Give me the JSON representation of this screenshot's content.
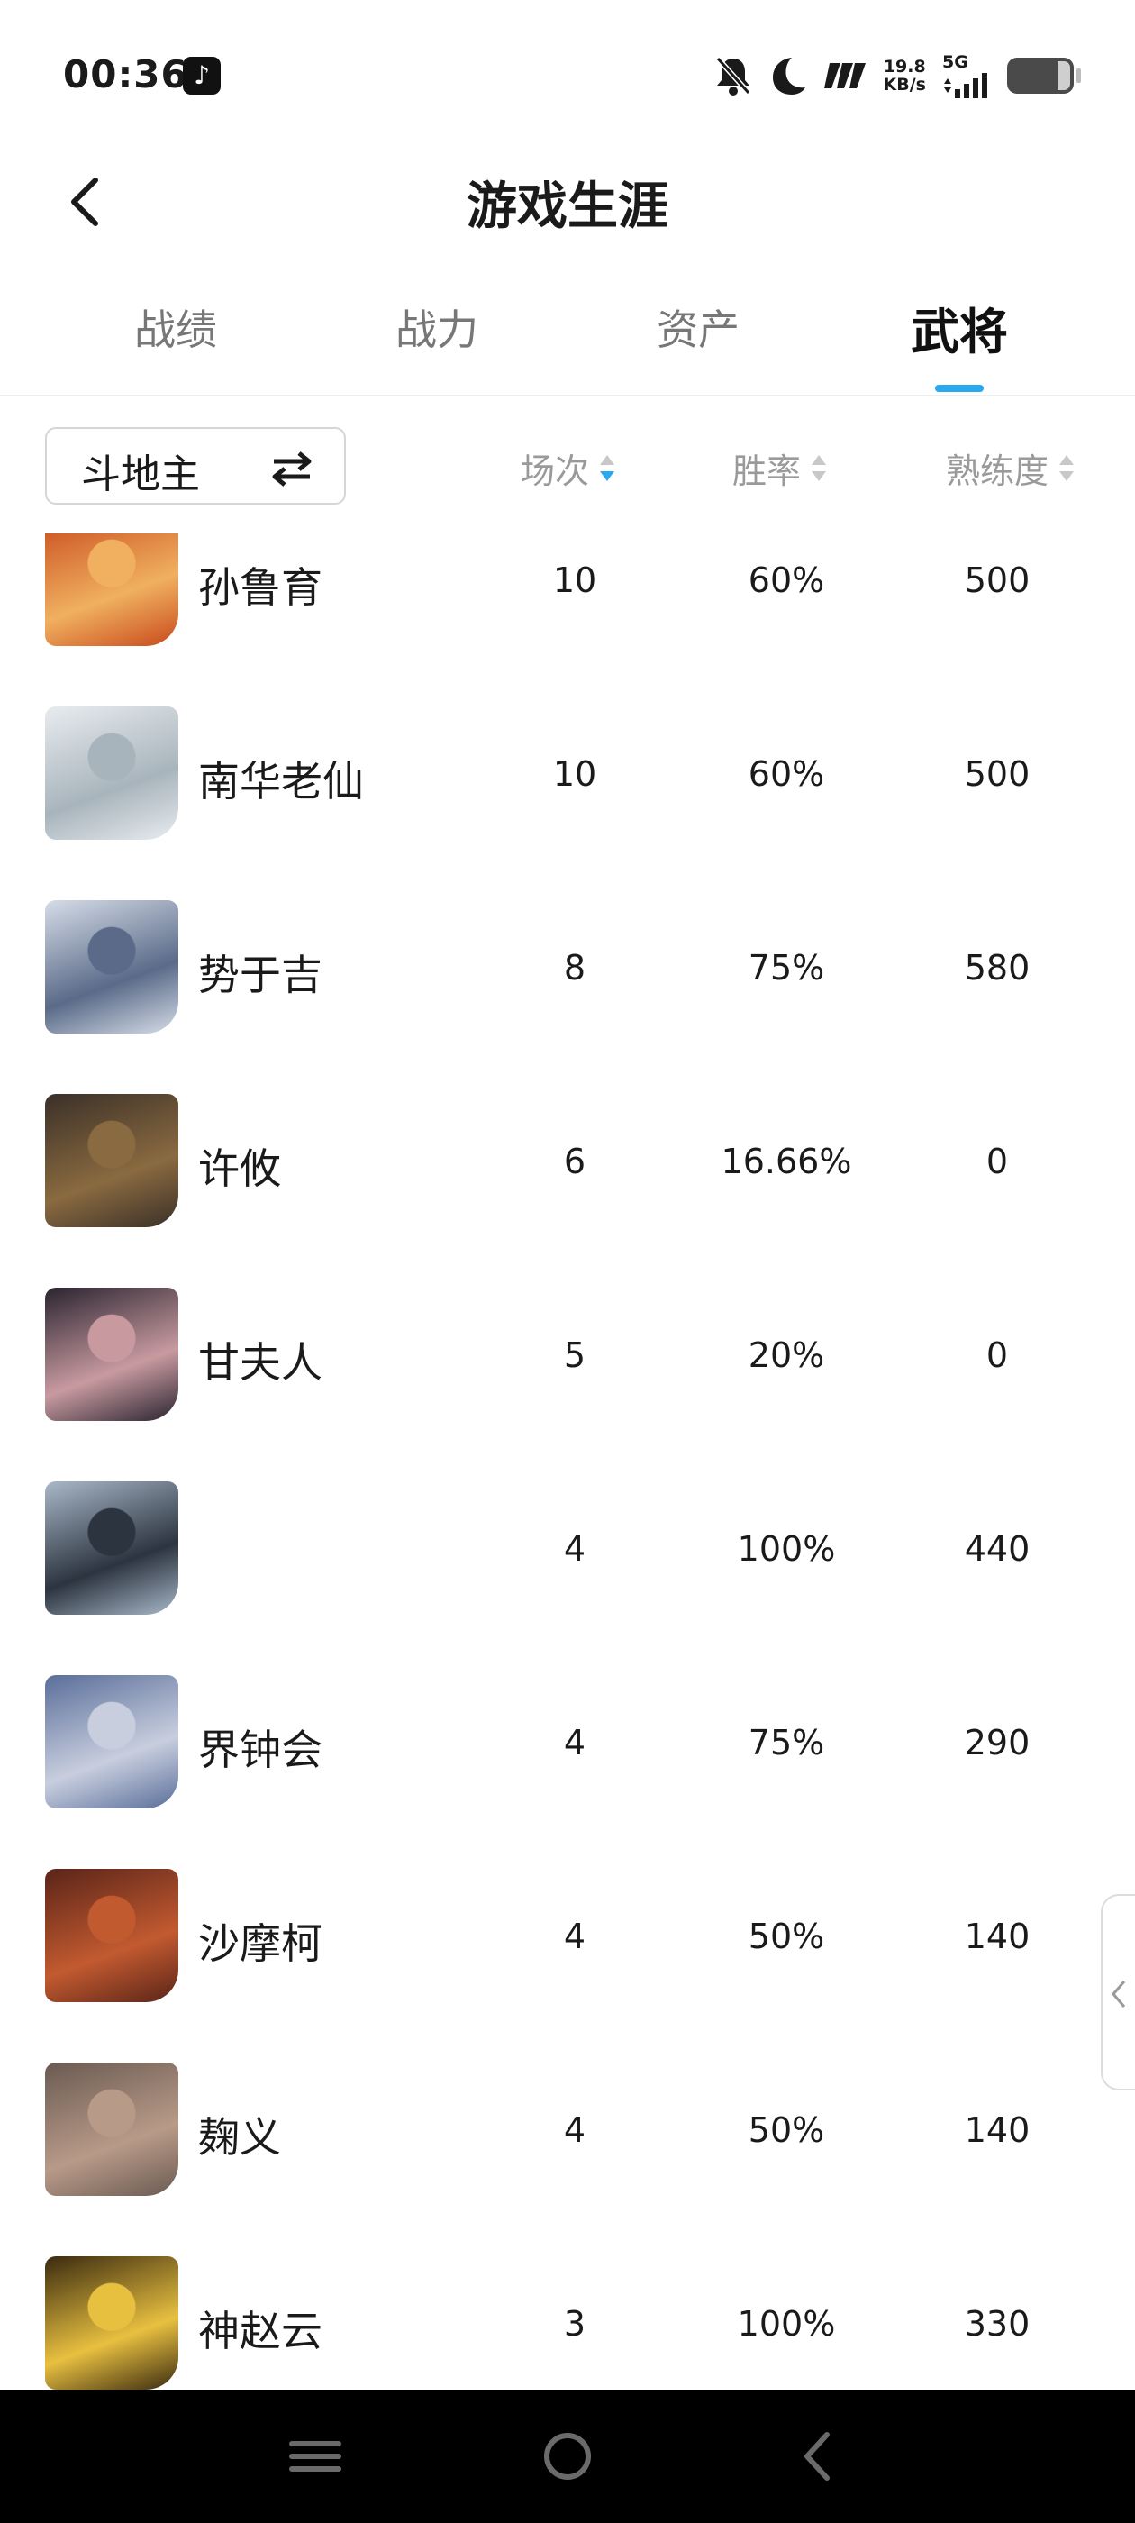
{
  "status_bar": {
    "time": "00:36",
    "net_speed_value": "19.8",
    "net_speed_unit": "KB/s",
    "network_type": "5G",
    "icons": [
      "tiktok-icon",
      "mute-bell-icon",
      "moon-icon",
      "hd-icon",
      "signal-icon",
      "battery-icon"
    ]
  },
  "header": {
    "title": "游戏生涯"
  },
  "tabs": [
    {
      "label": "战绩",
      "active": false
    },
    {
      "label": "战力",
      "active": false
    },
    {
      "label": "资产",
      "active": false
    },
    {
      "label": "武将",
      "active": true
    }
  ],
  "filter": {
    "mode": "斗地主",
    "columns": [
      {
        "label": "场次",
        "sort": "desc"
      },
      {
        "label": "胜率",
        "sort": "none"
      },
      {
        "label": "熟练度",
        "sort": "none"
      }
    ]
  },
  "colors": {
    "accent": "#2aa8f0",
    "sort_inactive": "#c8c8c8"
  },
  "heroes": [
    {
      "name": "孙鲁育",
      "games": "10",
      "win_rate": "60%",
      "proficiency": "500",
      "avatar_colors": [
        "#c84a1c",
        "#f0b060"
      ]
    },
    {
      "name": "南华老仙",
      "games": "10",
      "win_rate": "60%",
      "proficiency": "500",
      "avatar_colors": [
        "#e8ecef",
        "#a8b4bc"
      ]
    },
    {
      "name": "势于吉",
      "games": "8",
      "win_rate": "75%",
      "proficiency": "580",
      "avatar_colors": [
        "#d6dde8",
        "#5a6a88"
      ]
    },
    {
      "name": "许攸",
      "games": "6",
      "win_rate": "16.66%",
      "proficiency": "0",
      "avatar_colors": [
        "#3a3028",
        "#8a6a40"
      ]
    },
    {
      "name": "甘夫人",
      "games": "5",
      "win_rate": "20%",
      "proficiency": "0",
      "avatar_colors": [
        "#2a2430",
        "#c89aa0"
      ]
    },
    {
      "name": "",
      "games": "4",
      "win_rate": "100%",
      "proficiency": "440",
      "avatar_colors": [
        "#a9b8c8",
        "#2c3440"
      ]
    },
    {
      "name": "界钟会",
      "games": "4",
      "win_rate": "75%",
      "proficiency": "290",
      "avatar_colors": [
        "#5a6e9a",
        "#c8cede"
      ]
    },
    {
      "name": "沙摩柯",
      "games": "4",
      "win_rate": "50%",
      "proficiency": "140",
      "avatar_colors": [
        "#5a2418",
        "#c25a30"
      ]
    },
    {
      "name": "麹义",
      "games": "4",
      "win_rate": "50%",
      "proficiency": "140",
      "avatar_colors": [
        "#6a5a52",
        "#b89a88"
      ]
    },
    {
      "name": "神赵云",
      "games": "3",
      "win_rate": "100%",
      "proficiency": "330",
      "avatar_colors": [
        "#3a2a10",
        "#e8c040"
      ]
    }
  ],
  "nav_bar": {
    "buttons": [
      "menu-icon",
      "home-icon",
      "back-icon"
    ]
  }
}
